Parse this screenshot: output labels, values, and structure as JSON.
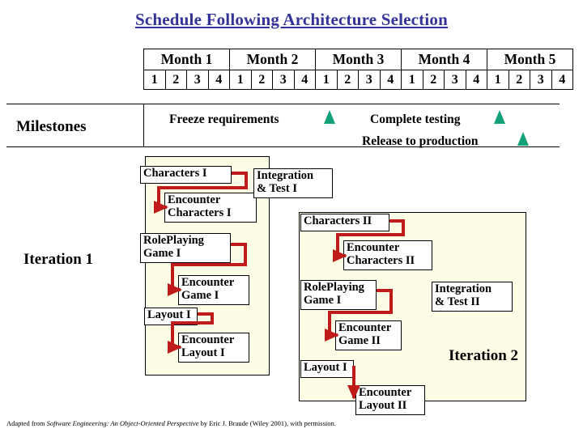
{
  "title": "Schedule Following Architecture Selection",
  "calendar": {
    "months": [
      "Month 1",
      "Month 2",
      "Month 3",
      "Month 4",
      "Month 5"
    ],
    "weeks": [
      "1",
      "2",
      "3",
      "4"
    ]
  },
  "row_labels": {
    "milestones": "Milestones",
    "iteration1": "Iteration 1",
    "iteration2": "Iteration 2"
  },
  "milestones": [
    {
      "label": "Freeze requirements",
      "marker": "green-triangle"
    },
    {
      "label": "Complete testing",
      "marker": "green-triangle"
    },
    {
      "label": "Release to production",
      "marker": "green-triangle"
    }
  ],
  "iteration1_tasks": [
    {
      "id": "chars1",
      "label": "Characters I"
    },
    {
      "id": "enc_chars1",
      "label": "Encounter\nCharacters I"
    },
    {
      "id": "int_test1",
      "label": "Integration\n& Test I"
    },
    {
      "id": "rpg1",
      "label": "RolePlaying\nGame I"
    },
    {
      "id": "enc_game1",
      "label": "Encounter\nGame I"
    },
    {
      "id": "layout1",
      "label": "Layout I"
    },
    {
      "id": "enc_lay1",
      "label": "Encounter\nLayout I"
    }
  ],
  "iteration2_tasks": [
    {
      "id": "chars2",
      "label": "Characters II"
    },
    {
      "id": "enc_chars2",
      "label": "Encounter\nCharacters II"
    },
    {
      "id": "rpg2",
      "label": "RolePlaying\nGame I"
    },
    {
      "id": "int_test2",
      "label": "Integration\n& Test II"
    },
    {
      "id": "enc_game2",
      "label": "Encounter\nGame II"
    },
    {
      "id": "layout2",
      "label": "Layout I"
    },
    {
      "id": "enc_lay2",
      "label": "Encounter\nLayout II"
    }
  ],
  "footnote": {
    "prefix": "Adapted from ",
    "book": "Software Engineering: An Object-Oriented Perspective",
    "suffix": " by Eric J. Braude (Wiley 2001), with permission."
  },
  "colors": {
    "title": "#333399",
    "panel": "#fdfce4",
    "arrow": "#c01b1b",
    "milestone_marker": "#13a179"
  }
}
